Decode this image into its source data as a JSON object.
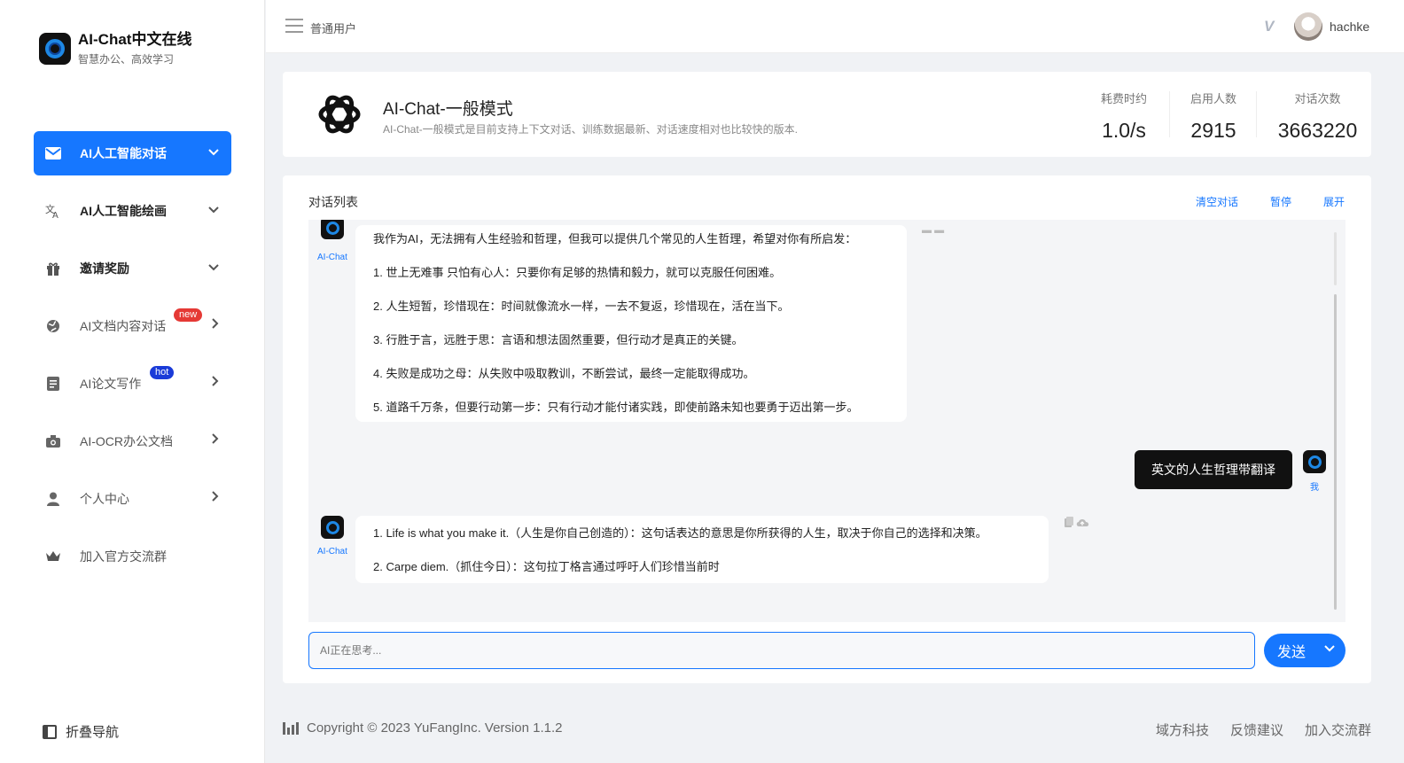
{
  "brand": {
    "title": "AI-Chat中文在线",
    "subtitle": "智慧办公、高效学习"
  },
  "sidebar": {
    "items": [
      {
        "label": "AI人工智能对话",
        "icon": "mail-icon",
        "arrow": "chevron-down",
        "active": true
      },
      {
        "label": "AI人工智能绘画",
        "icon": "translate-icon",
        "arrow": "chevron-down"
      },
      {
        "label": "邀请奖励",
        "icon": "gift-icon",
        "arrow": "chevron-down"
      },
      {
        "label": "AI文档内容对话",
        "icon": "globe-icon",
        "arrow": "chevron-right",
        "badge": "new"
      },
      {
        "label": "AI论文写作",
        "icon": "document-icon",
        "arrow": "chevron-right",
        "badge": "hot"
      },
      {
        "label": "AI-OCR办公文档",
        "icon": "camera-icon",
        "arrow": "chevron-right"
      },
      {
        "label": "个人中心",
        "icon": "person-icon",
        "arrow": "chevron-right"
      },
      {
        "label": "加入官方交流群",
        "icon": "crown-icon"
      }
    ],
    "collapse_label": "折叠导航"
  },
  "header": {
    "user_type": "普通用户",
    "vip_text": "V",
    "username": "hachke"
  },
  "model": {
    "title": "AI-Chat-一般模式",
    "description": "AI-Chat-一般模式是目前支持上下文对话、训练数据最新、对话速度相对也比较快的版本.",
    "stats": [
      {
        "label": "耗费时约",
        "value": "1.0/s"
      },
      {
        "label": "启用人数",
        "value": "2915"
      },
      {
        "label": "对话次数",
        "value": "3663220"
      }
    ]
  },
  "chat": {
    "title": "对话列表",
    "actions": {
      "clear": "清空对话",
      "pause": "暂停",
      "expand": "展开"
    },
    "bot_name": "AI-Chat",
    "me_name": "我",
    "messages": [
      {
        "role": "bot",
        "lines": [
          "我作为AI，无法拥有人生经验和哲理，但我可以提供几个常见的人生哲理，希望对你有所启发：",
          "1. 世上无难事 只怕有心人：只要你有足够的热情和毅力，就可以克服任何困难。",
          "2. 人生短暂，珍惜现在：时间就像流水一样，一去不复返，珍惜现在，活在当下。",
          "3. 行胜于言，远胜于思：言语和想法固然重要，但行动才是真正的关键。",
          "4. 失败是成功之母：从失败中吸取教训，不断尝试，最终一定能取得成功。",
          "5. 道路千万条，但要行动第一步：只有行动才能付诸实践，即使前路未知也要勇于迈出第一步。"
        ]
      },
      {
        "role": "user",
        "text": "英文的人生哲理带翻译"
      },
      {
        "role": "bot",
        "lines": [
          "1. Life is what you make it.（人生是你自己创造的）：这句话表达的意思是你所获得的人生，取决于你自己的选择和决策。",
          "2. Carpe diem.（抓住今日）：这句拉丁格言通过呼吁人们珍惜当前时"
        ]
      }
    ],
    "input_placeholder": "AI正在思考...",
    "send_label": "发送"
  },
  "footer": {
    "copyright": "Copyright © 2023 YuFangInc. Version 1.1.2",
    "links": [
      "域方科技",
      "反馈建议",
      "加入交流群"
    ]
  },
  "colors": {
    "primary": "#1677ff",
    "badge_new": "#e53935",
    "badge_hot": "#1a3bd8",
    "user_bubble": "#111111"
  }
}
